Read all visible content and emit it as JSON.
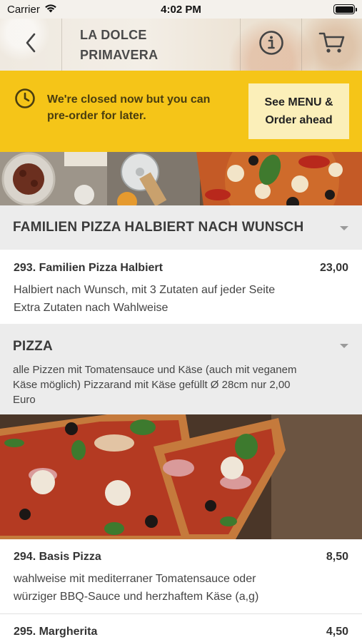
{
  "status_bar": {
    "carrier": "Carrier",
    "time": "4:02 PM"
  },
  "nav": {
    "title_line1": "LA DOLCE",
    "title_line2": "PRIMAVERA"
  },
  "banner": {
    "message_line1": "We're closed now but you can",
    "message_line2": "pre-order for later.",
    "button_line1": "See MENU &",
    "button_line2": "Order ahead"
  },
  "categories": [
    {
      "title": "FAMILIEN PIZZA HALBIERT NACH WUNSCH",
      "items": [
        {
          "name": "293. Familien Pizza Halbiert",
          "price": "23,00",
          "desc_line1": "Halbiert nach Wunsch, mit 3 Zutaten auf jeder Seite",
          "desc_line2": "Extra Zutaten nach Wahlweise"
        }
      ]
    },
    {
      "title": "PIZZA",
      "desc_line1": "alle Pizzen mit Tomatensauce und Käse (auch mit veganem",
      "desc_line2": "Käse möglich) Pizzarand mit Käse gefüllt Ø 28cm nur 2,00",
      "desc_line3": "Euro",
      "items": [
        {
          "name": "294. Basis Pizza",
          "price": "8,50",
          "desc_line1": "wahlweise mit mediterraner Tomatensauce oder",
          "desc_line2": "würziger BBQ-Sauce und herzhaftem Käse (a,g)"
        },
        {
          "name": "295. Margherita",
          "price": "4,50"
        }
      ]
    }
  ],
  "icons": {
    "back": "chevron-left-icon",
    "info": "info-icon",
    "cart": "cart-icon",
    "clock": "clock-icon",
    "expand": "triangle-down-icon"
  },
  "colors": {
    "banner": "#f5c518",
    "banner_button": "#fbefb9",
    "category_header": "#ececec"
  }
}
